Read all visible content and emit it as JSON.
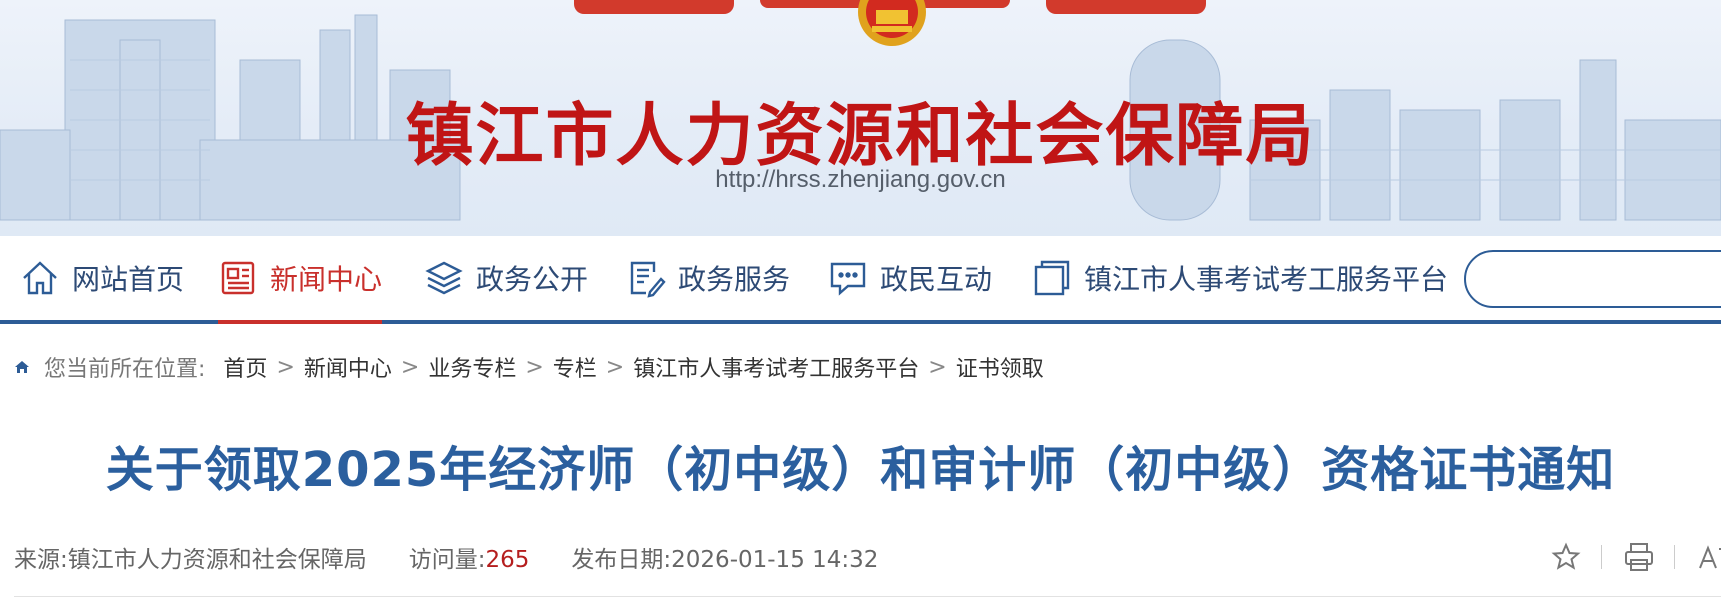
{
  "header": {
    "site_title": "镇江市人力资源和社会保障局",
    "site_url": "http://hrss.zhenjiang.gov.cn"
  },
  "nav": {
    "items": [
      {
        "label": "网站首页",
        "icon": "home-icon",
        "active": false
      },
      {
        "label": "新闻中心",
        "icon": "news-icon",
        "active": true
      },
      {
        "label": "政务公开",
        "icon": "layers-icon",
        "active": false
      },
      {
        "label": "政务服务",
        "icon": "document-edit-icon",
        "active": false
      },
      {
        "label": "政民互动",
        "icon": "chat-icon",
        "active": false
      },
      {
        "label": "镇江市人事考试考工服务平台",
        "icon": "window-icon",
        "active": false
      }
    ],
    "search_placeholder": ""
  },
  "breadcrumb": {
    "label": "您当前所在位置:",
    "items": [
      "首页",
      "新闻中心",
      "业务专栏",
      "专栏",
      "镇江市人事考试考工服务平台",
      "证书领取"
    ],
    "separator": ">"
  },
  "article": {
    "title": "关于领取2025年经济师（初中级）和审计师（初中级）资格证书通知",
    "source_label": "来源:",
    "source": "镇江市人力资源和社会保障局",
    "views_label": "访问量:",
    "views": "265",
    "date_label": "发布日期:",
    "date": "2026-01-15 14:32"
  },
  "colors": {
    "title_red": "#c01515",
    "nav_blue": "#2d4a75",
    "active_red": "#c9302c",
    "article_title_blue": "#2b5f9e",
    "views_red": "#b51e1e"
  }
}
